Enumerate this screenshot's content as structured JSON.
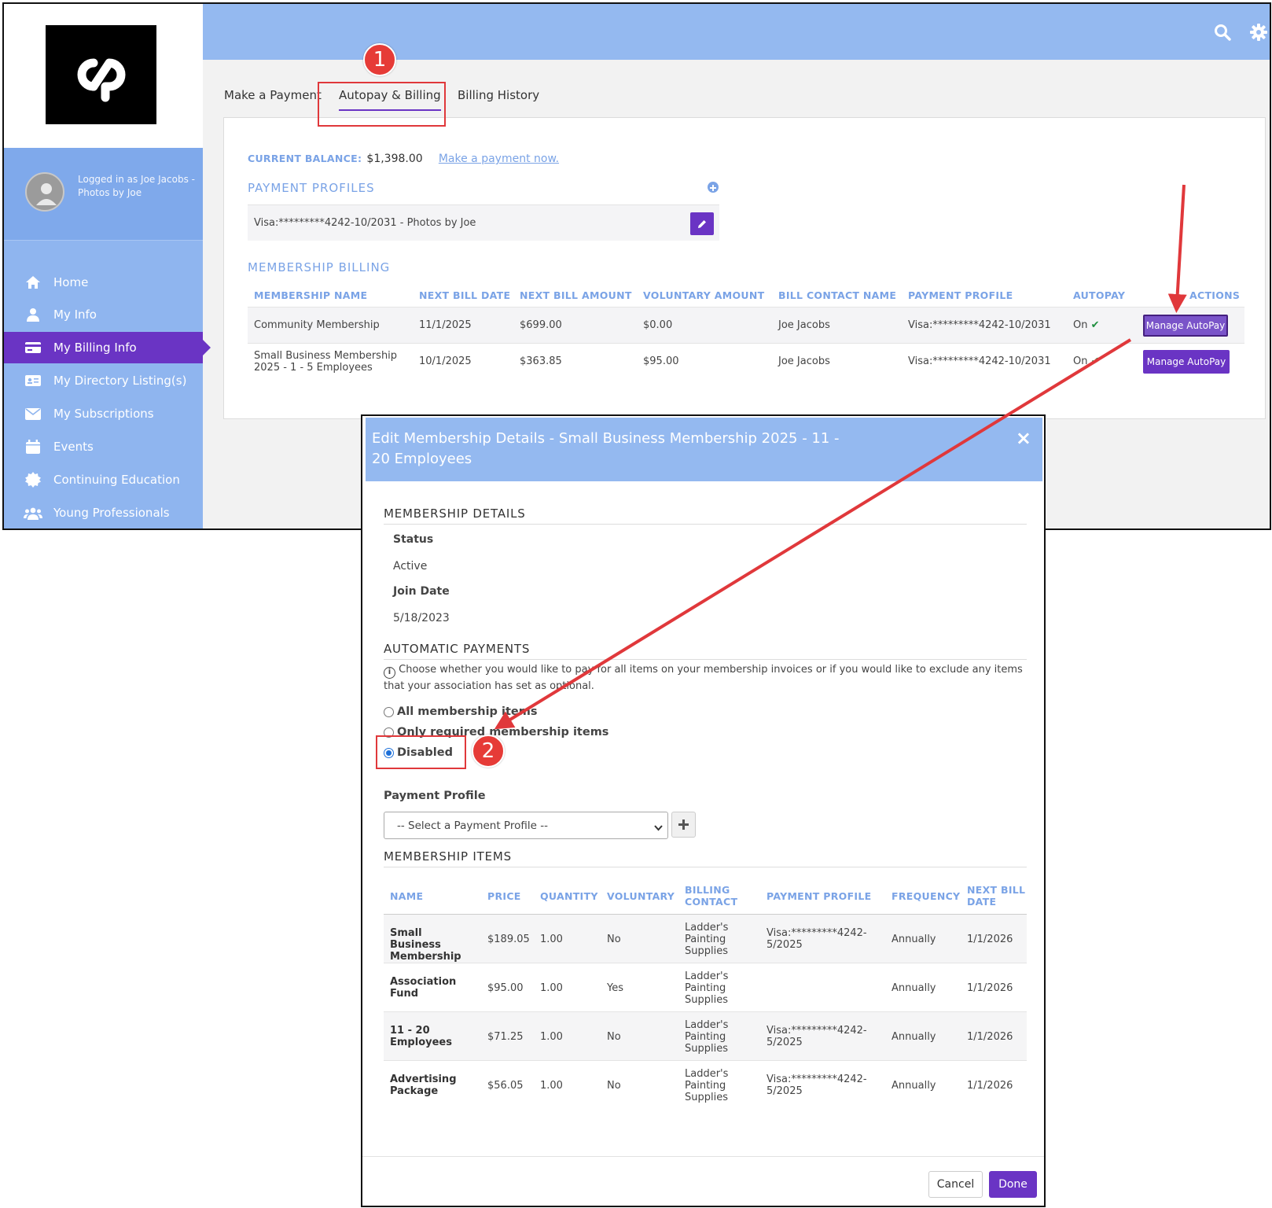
{
  "sidebar": {
    "user_text": "Logged in as Joe Jacobs - Photos by Joe",
    "items": [
      {
        "label": "Home",
        "icon": "home-icon"
      },
      {
        "label": "My Info",
        "icon": "user-icon"
      },
      {
        "label": "My Billing Info",
        "icon": "credit-card-icon",
        "active": true
      },
      {
        "label": "My Directory Listing(s)",
        "icon": "id-card-icon"
      },
      {
        "label": "My Subscriptions",
        "icon": "envelope-icon"
      },
      {
        "label": "Events",
        "icon": "calendar-icon"
      },
      {
        "label": "Continuing Education",
        "icon": "certificate-icon"
      },
      {
        "label": "Young Professionals",
        "icon": "users-icon"
      }
    ]
  },
  "tabs": [
    "Make a Payment",
    "Autopay & Billing",
    "Billing History"
  ],
  "balance": {
    "label": "CURRENT BALANCE:",
    "value": "$1,398.00",
    "link": "Make a payment now."
  },
  "payment_profiles": {
    "title": "PAYMENT PROFILES",
    "items": [
      "Visa:*********4242-10/2031 - Photos by Joe"
    ]
  },
  "membership_billing": {
    "title": "MEMBERSHIP BILLING",
    "headers": [
      "MEMBERSHIP NAME",
      "NEXT BILL DATE",
      "NEXT BILL AMOUNT",
      "VOLUNTARY AMOUNT",
      "BILL CONTACT NAME",
      "PAYMENT PROFILE",
      "AUTOPAY",
      "ACTIONS"
    ],
    "rows": [
      {
        "name": "Community Membership",
        "date": "11/1/2025",
        "amount": "$699.00",
        "voluntary": "$0.00",
        "contact": "Joe Jacobs",
        "profile": "Visa:*********4242-10/2031",
        "autopay": "On",
        "action": "Manage AutoPay"
      },
      {
        "name": "Small Business Membership 2025 - 1 - 5 Employees",
        "date": "10/1/2025",
        "amount": "$363.85",
        "voluntary": "$95.00",
        "contact": "Joe Jacobs",
        "profile": "Visa:*********4242-10/2031",
        "autopay": "On",
        "action": "Manage AutoPay"
      }
    ]
  },
  "modal": {
    "title": "Edit Membership Details - Small Business Membership 2025 - 11 - 20 Employees",
    "close": "×",
    "details_title": "MEMBERSHIP DETAILS",
    "status_label": "Status",
    "status_value": "Active",
    "join_label": "Join Date",
    "join_value": "5/18/2023",
    "auto_title": "AUTOMATIC PAYMENTS",
    "auto_info": "Choose whether you would like to pay for all items on your membership invoices or if you would like to exclude any items that your association has set as optional.",
    "options": [
      "All membership items",
      "Only required membership items",
      "Disabled"
    ],
    "selected_option": "Disabled",
    "profile_label": "Payment Profile",
    "profile_placeholder": "-- Select a Payment Profile --",
    "items_title": "MEMBERSHIP ITEMS",
    "items_headers": [
      "NAME",
      "PRICE",
      "QUANTITY",
      "VOLUNTARY",
      "BILLING CONTACT",
      "PAYMENT PROFILE",
      "FREQUENCY",
      "NEXT BILL DATE"
    ],
    "items": [
      {
        "name": "Small Business Membership",
        "price": "$189.05",
        "qty": "1.00",
        "voluntary": "No",
        "contact": "Ladder's Painting Supplies",
        "profile": "Visa:*********4242-5/2025",
        "freq": "Annually",
        "next": "1/1/2026"
      },
      {
        "name": "Association Fund",
        "price": "$95.00",
        "qty": "1.00",
        "voluntary": "Yes",
        "contact": "Ladder's Painting Supplies",
        "profile": "",
        "freq": "Annually",
        "next": "1/1/2026"
      },
      {
        "name": "11 - 20 Employees",
        "price": "$71.25",
        "qty": "1.00",
        "voluntary": "No",
        "contact": "Ladder's Painting Supplies",
        "profile": "Visa:*********4242-5/2025",
        "freq": "Annually",
        "next": "1/1/2026"
      },
      {
        "name": "Advertising Package",
        "price": "$56.05",
        "qty": "1.00",
        "voluntary": "No",
        "contact": "Ladder's Painting Supplies",
        "profile": "Visa:*********4242-5/2025",
        "freq": "Annually",
        "next": "1/1/2026"
      }
    ],
    "cancel": "Cancel",
    "done": "Done"
  },
  "annotations": {
    "step1": "1",
    "step2": "2"
  },
  "colors": {
    "accent": "#6a34c4",
    "header_blue": "#94b9f0",
    "annotation_red": "#e0383b"
  }
}
